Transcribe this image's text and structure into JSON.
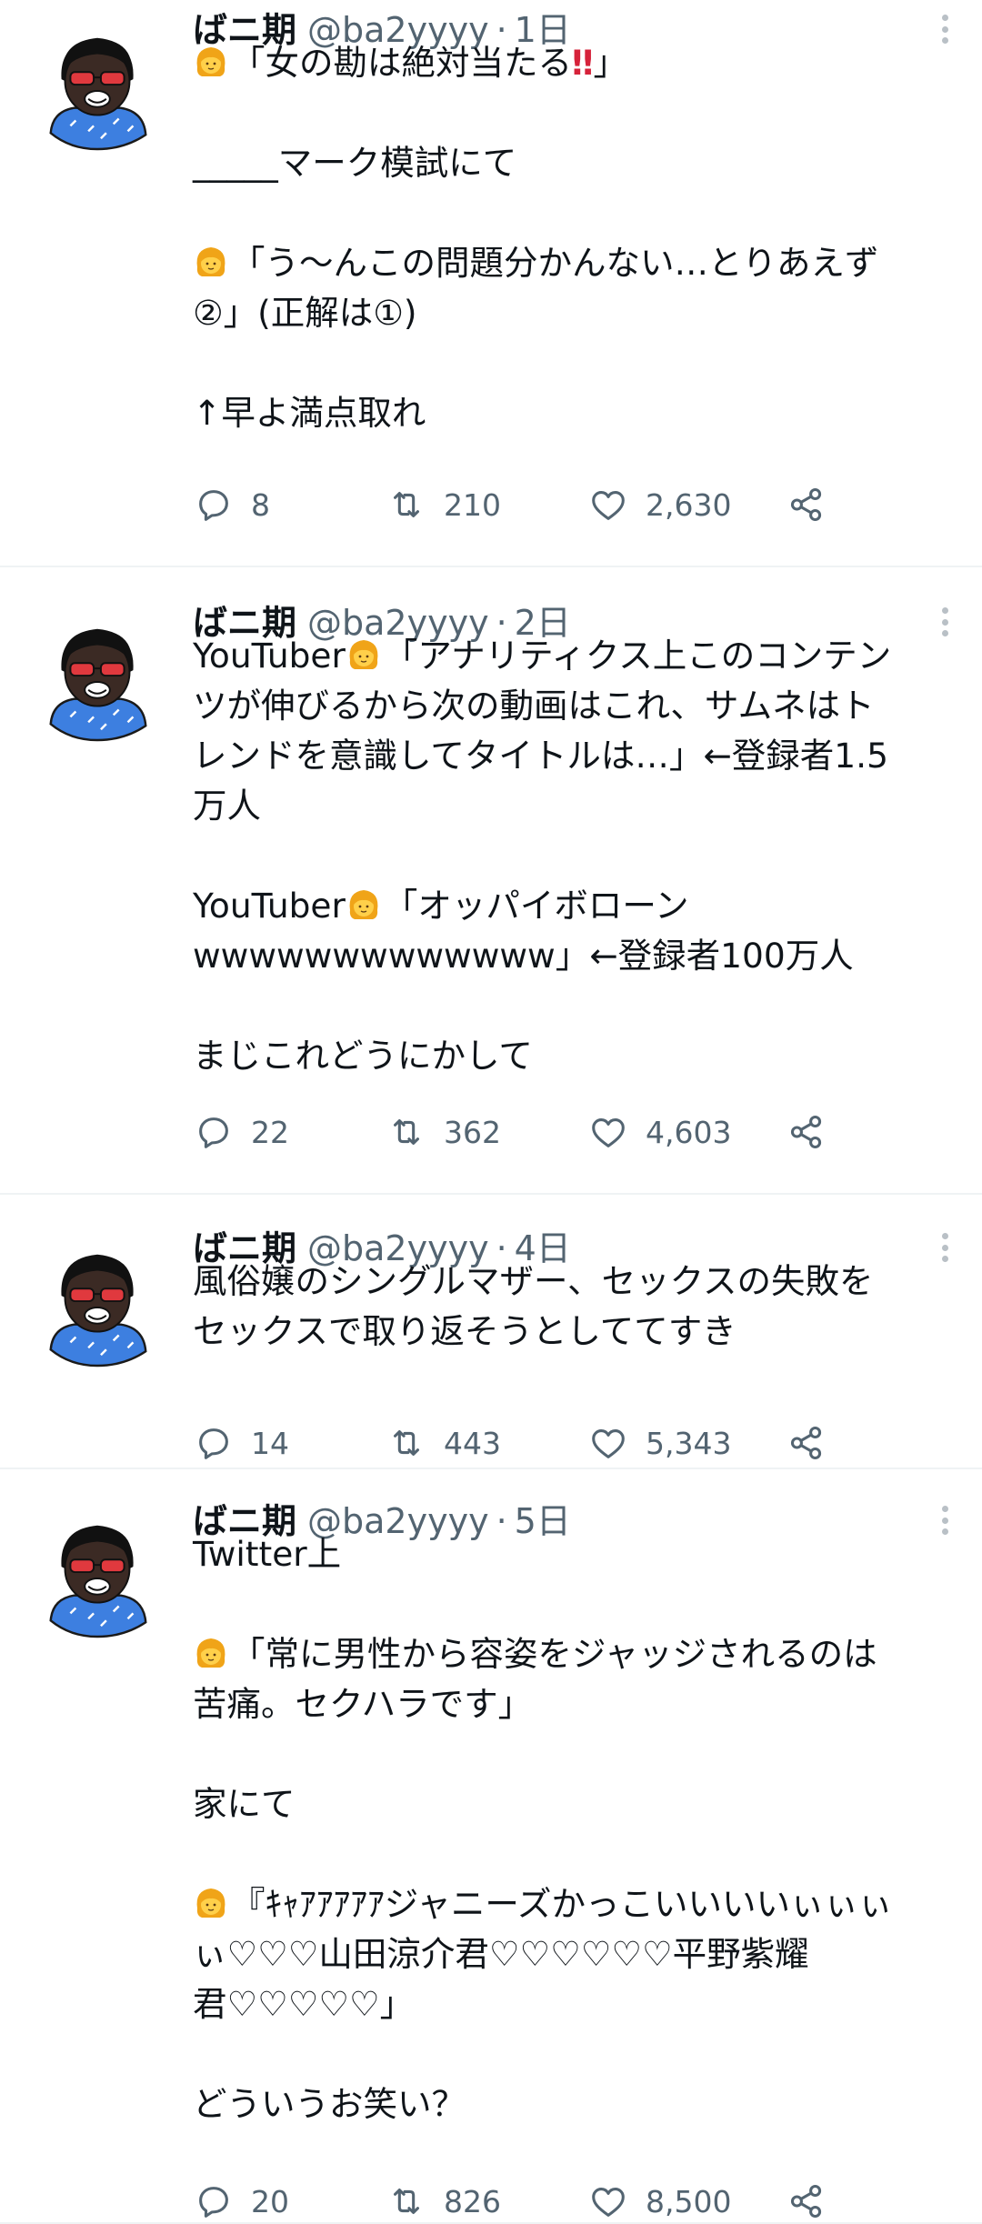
{
  "tweets": [
    {
      "name": "ばニ期",
      "handle": "@ba2yyyy",
      "separator": "·",
      "time": "1日",
      "lines": [
        {
          "emoji": true,
          "text": "「女の勘は絶対当たる",
          "bang": "‼",
          "after": "」"
        },
        {
          "text": ""
        },
        {
          "text": "_____マーク模試にて"
        },
        {
          "text": ""
        },
        {
          "emoji": true,
          "text": "「う～んこの問題分かんない…とりあえず"
        },
        {
          "text": "②」(正解は①)"
        },
        {
          "text": ""
        },
        {
          "text": "↑早よ満点取れ"
        }
      ],
      "replies": "8",
      "retweets": "210",
      "likes": "2,630"
    },
    {
      "name": "ばニ期",
      "handle": "@ba2yyyy",
      "separator": "·",
      "time": "2日",
      "lines": [
        {
          "prefix": "YouTuber",
          "emoji": true,
          "text": "「アナリティクス上このコンテン"
        },
        {
          "text": "ツが伸びるから次の動画はこれ、サムネはト"
        },
        {
          "text": "レンドを意識してタイトルは…」←登録者1.5"
        },
        {
          "text": "万人"
        },
        {
          "text": ""
        },
        {
          "prefix": "YouTuber",
          "emoji": true,
          "text": "「オッパイボローン"
        },
        {
          "text": "wwwwwwwwwwwww」←登録者100万人"
        },
        {
          "text": ""
        },
        {
          "text": "まじこれどうにかして"
        }
      ],
      "replies": "22",
      "retweets": "362",
      "likes": "4,603"
    },
    {
      "name": "ばニ期",
      "handle": "@ba2yyyy",
      "separator": "·",
      "time": "4日",
      "lines": [
        {
          "text": "風俗嬢のシングルマザー、セックスの失敗を"
        },
        {
          "text": "セックスで取り返そうとしててすき"
        }
      ],
      "replies": "14",
      "retweets": "443",
      "likes": "5,343"
    },
    {
      "name": "ばニ期",
      "handle": "@ba2yyyy",
      "separator": "·",
      "time": "5日",
      "lines": [
        {
          "text": "Twitter上"
        },
        {
          "text": ""
        },
        {
          "emoji": true,
          "text": "「常に男性から容姿をジャッジされるのは"
        },
        {
          "text": "苦痛。セクハラです」"
        },
        {
          "text": ""
        },
        {
          "text": "家にて"
        },
        {
          "text": ""
        },
        {
          "emoji": true,
          "text": "『ｷｬｱｱｱｱｱジャニーズかっこいいいいぃぃぃ"
        },
        {
          "text": "ぃ♡♡♡山田涼介君♡♡♡♡♡♡平野紫耀"
        },
        {
          "text": "君♡♡♡♡♡」"
        },
        {
          "text": ""
        },
        {
          "text": "どういうお笑い？"
        }
      ],
      "replies": "20",
      "retweets": "826",
      "likes": "8,500"
    }
  ],
  "icons": {
    "reply": "reply-icon",
    "retweet": "retweet-icon",
    "like": "heart-icon",
    "share": "share-icon",
    "more": "more-vertical-icon",
    "emoji": "woman-emoji-icon"
  },
  "colors": {
    "text": "#0f1419",
    "secondary": "#536471",
    "divider": "#eff3f4",
    "avatar_shirt": "#3d7fe0",
    "avatar_glasses": "#e0393e"
  }
}
